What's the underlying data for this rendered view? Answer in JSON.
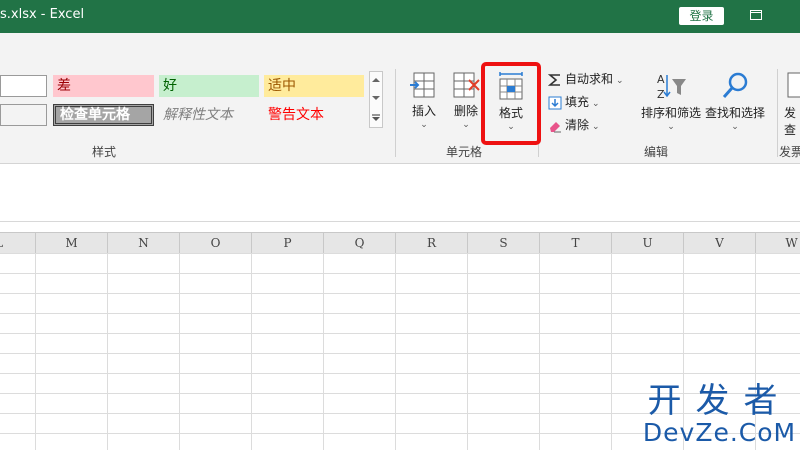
{
  "titlebar": {
    "title": "s.xlsx  -  Excel",
    "login_label": "登录",
    "window_icon": "ribbon-display-icon"
  },
  "styles_gallery": {
    "cells": {
      "normal_top": "",
      "normal_bottom": "",
      "bad": "差",
      "good": "好",
      "neutral": "适中",
      "check_cell": "检查单元格",
      "explanatory": "解释性文本",
      "warning": "警告文本"
    },
    "group_label": "样式"
  },
  "cells_group": {
    "insert_label": "插入",
    "delete_label": "删除",
    "format_label": "格式",
    "group_label": "单元格",
    "highlighted": "format"
  },
  "editing_group": {
    "autosum_label": "自动求和",
    "fill_label": "填充",
    "clear_label": "清除",
    "sort_filter_label": "排序和筛选",
    "find_select_label": "查找和选择",
    "group_label": "编辑"
  },
  "partial_group": {
    "top_label": "发",
    "mid_label": "查",
    "group_label": "发票"
  },
  "columns": [
    "L",
    "M",
    "N",
    "O",
    "P",
    "Q",
    "R",
    "S",
    "T",
    "U",
    "V",
    "W"
  ],
  "watermark": {
    "cn": "开发者",
    "en": "DevZe.CoM"
  },
  "colors": {
    "excel_green": "#217346",
    "highlight_red": "#ee1111",
    "watermark_blue": "#1b5aa8"
  }
}
